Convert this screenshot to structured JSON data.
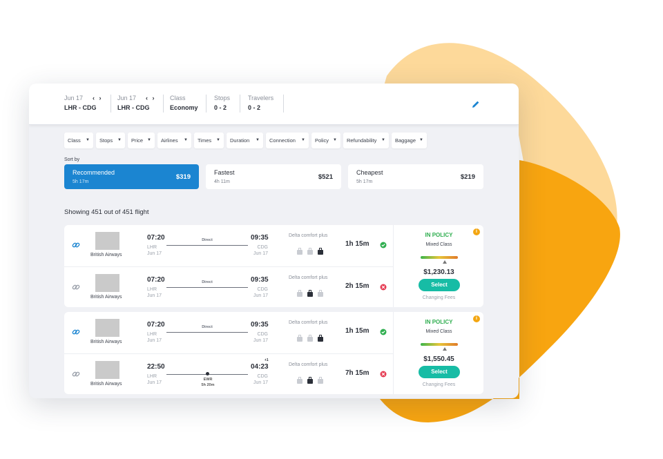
{
  "search": {
    "segments": [
      {
        "date": "Jun 17",
        "route": "LHR - CDG"
      },
      {
        "date": "Jun 17",
        "route": "LHR - CDG"
      }
    ],
    "class": {
      "label": "Class",
      "value": "Economy"
    },
    "stops": {
      "label": "Stops",
      "value": "0 - 2"
    },
    "travelers": {
      "label": "Travelers",
      "value": "0 - 2"
    },
    "arrows": "‹ ›"
  },
  "filters": [
    "Class",
    "Stops",
    "Price",
    "Airlines",
    "Times",
    "Duration",
    "Connection",
    "Policy",
    "Refundability",
    "Baggage"
  ],
  "sort": {
    "label": "Sort by",
    "tabs": [
      {
        "title": "Recommended",
        "duration": "5h 17m",
        "price": "$319"
      },
      {
        "title": "Fastest",
        "duration": "4h 11m",
        "price": "$521"
      },
      {
        "title": "Cheapest",
        "duration": "5h 17m",
        "price": "$219"
      }
    ]
  },
  "results_summary": "Showing 451 out of 451 flight",
  "colors": {
    "accent": "#1b85d1",
    "select": "#17bca5",
    "policy": "#2fae4f",
    "blob_light": "#fdd99a",
    "blob_dark": "#f8a510"
  },
  "groups": [
    {
      "policy": "IN POLICY",
      "class": "Mixed Class",
      "price": "$1,230.13",
      "select": "Select",
      "fees": "Changing Fees",
      "info": "i",
      "flights": [
        {
          "airline": "British Airways",
          "dep_time": "07:20",
          "dep_ap": "LHR",
          "dep_date": "Jun 17",
          "arr_time": "09:35",
          "arr_ap": "CDG",
          "arr_date": "Jun 17",
          "stop_label": "Direct",
          "cabin": "Delta comfort plus",
          "duration": "1h 15m",
          "status": "ok",
          "link_icon": "link-icon-blue"
        },
        {
          "airline": "British Airways",
          "dep_time": "07:20",
          "dep_ap": "LHR",
          "dep_date": "Jun 17",
          "arr_time": "09:35",
          "arr_ap": "CDG",
          "arr_date": "Jun 17",
          "stop_label": "Direct",
          "cabin": "Delta comfort plus",
          "duration": "2h 15m",
          "status": "blocked",
          "link_icon": "link-icon-gray"
        }
      ]
    },
    {
      "policy": "IN POLICY",
      "class": "Mixed Class",
      "price": "$1,550.45",
      "select": "Select",
      "fees": "Changing Fees",
      "info": "i",
      "flights": [
        {
          "airline": "British Airways",
          "dep_time": "07:20",
          "dep_ap": "LHR",
          "dep_date": "Jun 17",
          "arr_time": "09:35",
          "arr_ap": "CDG",
          "arr_date": "Jun 17",
          "stop_label": "Direct",
          "cabin": "Delta comfort plus",
          "duration": "1h 15m",
          "status": "ok",
          "link_icon": "link-icon-blue"
        },
        {
          "airline": "British Airways",
          "dep_time": "22:50",
          "dep_ap": "LHR",
          "dep_date": "Jun 17",
          "arr_time": "04:23",
          "arr_ap": "CDG",
          "arr_date": "Jun 17",
          "next_day": "+1",
          "stop_airport": "EWR",
          "stop_duration": "5h 20m",
          "cabin": "Delta comfort plus",
          "duration": "7h 15m",
          "status": "blocked",
          "link_icon": "link-icon-gray"
        }
      ]
    }
  ]
}
